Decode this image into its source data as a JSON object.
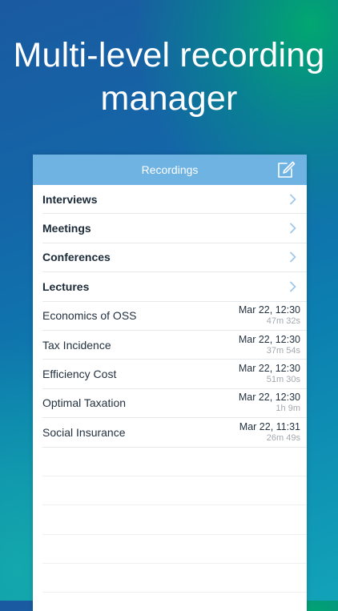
{
  "headline": {
    "line1": "Multi-level recording",
    "line2": "manager"
  },
  "navbar": {
    "title": "Recordings",
    "compose_icon": "compose-icon"
  },
  "folders": [
    {
      "label": "Interviews"
    },
    {
      "label": "Meetings"
    },
    {
      "label": "Conferences"
    },
    {
      "label": "Lectures"
    }
  ],
  "recordings": [
    {
      "title": "Economics of OSS",
      "date": "Mar 22, 12:30",
      "duration": "47m 32s"
    },
    {
      "title": "Tax Incidence",
      "date": "Mar 22, 12:30",
      "duration": "37m 54s"
    },
    {
      "title": "Efficiency Cost",
      "date": "Mar 22, 12:30",
      "duration": "51m 30s"
    },
    {
      "title": "Optimal Taxation",
      "date": "Mar 22, 12:30",
      "duration": "1h 9m"
    },
    {
      "title": "Social Insurance",
      "date": "Mar 22, 11:31",
      "duration": "26m 49s"
    }
  ],
  "colors": {
    "navbar": "#6fb3e3",
    "text": "#243240",
    "secondary_text": "#a2a8ae",
    "chevron": "#9ec8ea"
  }
}
